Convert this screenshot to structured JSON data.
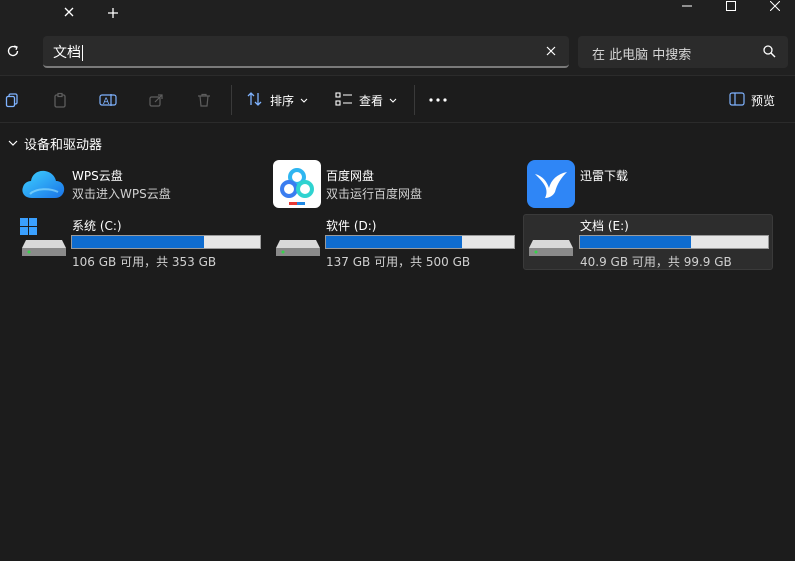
{
  "titlebar": {
    "icons": [
      "close-tab-icon",
      "add-tab-icon",
      "minimize-icon",
      "maximize-icon",
      "close-window-icon"
    ]
  },
  "address": {
    "value": "文档",
    "clear_icon": "clear-icon"
  },
  "search": {
    "placeholder": "在 此电脑 中搜索",
    "icon": "search-icon"
  },
  "toolbar": {
    "sort_label": "排序",
    "view_label": "查看",
    "preview_label": "预览",
    "icons": [
      "copy-icon",
      "paste-icon",
      "rename-icon",
      "share-icon",
      "delete-icon",
      "sort-icon",
      "view-icon",
      "more-icon",
      "preview-pane-icon"
    ]
  },
  "section": {
    "title": "设备和驱动器"
  },
  "apps": [
    {
      "name": "WPS云盘",
      "subtitle": "双击进入WPS云盘",
      "icon": "wps-cloud-icon"
    },
    {
      "name": "百度网盘",
      "subtitle": "双击运行百度网盘",
      "icon": "baidu-netdisk-icon"
    },
    {
      "name": "迅雷下载",
      "subtitle": "",
      "icon": "xunlei-icon"
    }
  ],
  "drives": [
    {
      "label": "系统 (C:)",
      "free_text": "106 GB 可用，共 353 GB",
      "used_fraction": 0.7,
      "icon": "system-drive-icon"
    },
    {
      "label": "软件 (D:)",
      "free_text": "137 GB 可用，共 500 GB",
      "used_fraction": 0.726,
      "icon": "drive-icon"
    },
    {
      "label": "文档 (E:)",
      "free_text": "40.9 GB 可用，共 99.9 GB",
      "used_fraction": 0.59,
      "icon": "drive-icon"
    }
  ],
  "colors": {
    "accent": "#0f6ccf",
    "background": "#1c1c1c",
    "chrome": "#202020"
  }
}
